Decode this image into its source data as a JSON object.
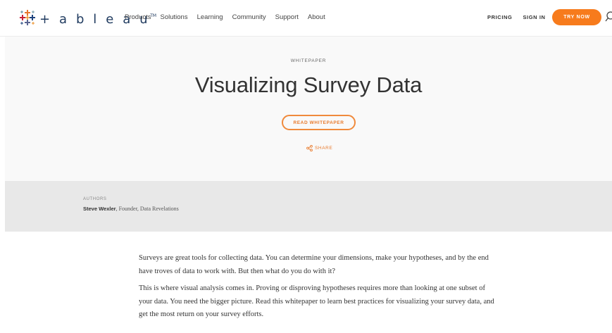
{
  "header": {
    "brand": "+ a b l e a u",
    "brand_mark": "TM",
    "nav": [
      "Products",
      "Solutions",
      "Learning",
      "Community",
      "Support",
      "About"
    ],
    "pricing": "PRICING",
    "sign_in": "SIGN IN",
    "try_now": "TRY NOW"
  },
  "hero": {
    "eyebrow": "WHITEPAPER",
    "title": "Visualizing Survey Data",
    "cta": "READ WHITEPAPER",
    "share": "SHARE"
  },
  "authors": {
    "label": "AUTHORS",
    "name": "Steve Wexler",
    "role": ", Founder, Data Revelations"
  },
  "body": {
    "paragraphs": [
      "Surveys are great tools for collecting data. You can determine your dimensions, make your hypotheses, and by the end have troves of data to work with. But then what do you do with it?",
      "This is where visual analysis comes in. Proving or disproving hypotheses requires more than looking at one subset of your data. You need the bigger picture. Read this whitepaper to learn best practices for visualizing your survey data, and get the most return on your survey efforts."
    ]
  },
  "colors": {
    "accent": "#f77b1c",
    "brand_blue": "#1f3a5f",
    "hero_bg": "#f9f9f9",
    "authors_bg": "#e8e8e8"
  }
}
